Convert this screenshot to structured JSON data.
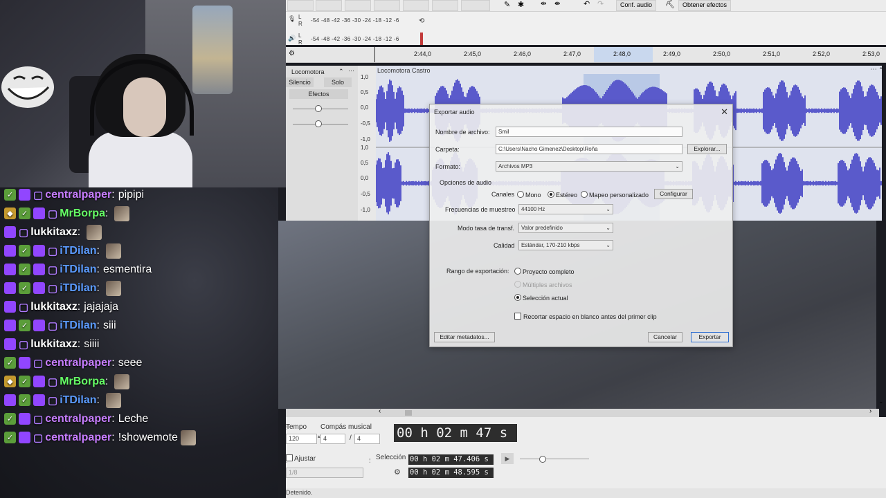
{
  "chat": [
    {
      "user": "centralpaper",
      "color": "#c77dff",
      "badges": [
        "vip",
        "sub"
      ],
      "message": "pipipi",
      "emote": false
    },
    {
      "user": "MrBorpa",
      "color": "#66ff66",
      "badges": [
        "bits",
        "vip",
        "sub"
      ],
      "message": "",
      "emote": true
    },
    {
      "user": "lukkitaxz",
      "color": "#ffffff",
      "badges": [
        "sub"
      ],
      "message": "",
      "emote": true
    },
    {
      "user": "iTDilan",
      "color": "#5b9bff",
      "badges": [
        "sub",
        "vip",
        "sub"
      ],
      "message": "",
      "emote": true
    },
    {
      "user": "iTDilan",
      "color": "#5b9bff",
      "badges": [
        "sub",
        "vip",
        "sub"
      ],
      "message": "esmentira",
      "emote": false
    },
    {
      "user": "iTDilan",
      "color": "#5b9bff",
      "badges": [
        "sub",
        "vip",
        "sub"
      ],
      "message": "",
      "emote": true
    },
    {
      "user": "lukkitaxz",
      "color": "#ffffff",
      "badges": [
        "sub"
      ],
      "message": "jajajaja",
      "emote": false
    },
    {
      "user": "iTDilan",
      "color": "#5b9bff",
      "badges": [
        "sub",
        "vip",
        "sub"
      ],
      "message": "siii",
      "emote": false
    },
    {
      "user": "lukkitaxz",
      "color": "#ffffff",
      "badges": [
        "sub"
      ],
      "message": "siiii",
      "emote": false
    },
    {
      "user": "centralpaper",
      "color": "#c77dff",
      "badges": [
        "vip",
        "sub"
      ],
      "message": "seee",
      "emote": false
    },
    {
      "user": "MrBorpa",
      "color": "#66ff66",
      "badges": [
        "bits",
        "vip",
        "sub"
      ],
      "message": "",
      "emote": true
    },
    {
      "user": "iTDilan",
      "color": "#5b9bff",
      "badges": [
        "sub",
        "vip",
        "sub"
      ],
      "message": "",
      "emote": true
    },
    {
      "user": "centralpaper",
      "color": "#c77dff",
      "badges": [
        "vip",
        "sub"
      ],
      "message": "Leche",
      "emote": false
    },
    {
      "user": "centralpaper",
      "color": "#c77dff",
      "badges": [
        "vip",
        "sub"
      ],
      "message": "!showemote",
      "emote": true
    }
  ],
  "toolbar": {
    "audio_setup": "Conf. audio",
    "get_effects": "Obtener efectos"
  },
  "meters": {
    "scale": "-54 -48 -42 -36 -30 -24 -18 -12 -6",
    "l": "L",
    "r": "R"
  },
  "ruler": {
    "ticks": [
      "2:44,0",
      "2:45,0",
      "2:46,0",
      "2:47,0",
      "2:48,0",
      "2:49,0",
      "2:50,0",
      "2:51,0",
      "2:52,0",
      "2:53,0"
    ]
  },
  "track": {
    "name": "Locomotora",
    "clip_name": "Locomotora Castro",
    "mute": "Silencio",
    "solo": "Solo",
    "effects": "Efectos",
    "axis": [
      "1,0",
      "0,5",
      "0,0",
      "-0,5",
      "-1,0",
      "1,0",
      "0,5",
      "0,0",
      "-0,5",
      "-1,0"
    ]
  },
  "dialog": {
    "title": "Exportar audio",
    "filename_label": "Nombre de archivo:",
    "filename_value": "Smil",
    "folder_label": "Carpeta:",
    "folder_value": "C:\\Users\\Nacho Gimenez\\Desktop\\Roña",
    "browse": "Explorar...",
    "format_label": "Formato:",
    "format_value": "Archivos MP3",
    "audio_options": "Opciones de audio",
    "channels_label": "Canales",
    "mono": "Mono",
    "stereo": "Estéreo",
    "custom_mapping": "Mapeo personalizado",
    "configure": "Configurar",
    "sample_rate_label": "Frecuencias de muestreo",
    "sample_rate_value": "44100 Hz",
    "bitrate_mode_label": "Modo tasa de transf.",
    "bitrate_mode_value": "Valor predefinido",
    "quality_label": "Calidad",
    "quality_value": "Estándar, 170-210 kbps",
    "range_label": "Rango de exportación:",
    "entire_project": "Proyecto completo",
    "multiple_files": "Múltiples archivos",
    "current_selection": "Selección actual",
    "trim_label": "Recortar espacio en blanco antes del primer clip",
    "edit_metadata": "Editar metadatos...",
    "cancel": "Cancelar",
    "export": "Exportar"
  },
  "bottom": {
    "tempo_label": "Tempo",
    "tempo_value": "120",
    "meter_label": "Compás musical",
    "meter_num": "4",
    "meter_den": "4",
    "meter_sep": "/",
    "time_display": "00 h 02 m 47 s",
    "snap_label": "Ajustar",
    "snap_value": "1/8",
    "selection_label": "Selección",
    "sel_start": "00 h 02 m 47.406 s",
    "sel_end": "00 h 02 m 48.595 s"
  },
  "status": "Detenido."
}
